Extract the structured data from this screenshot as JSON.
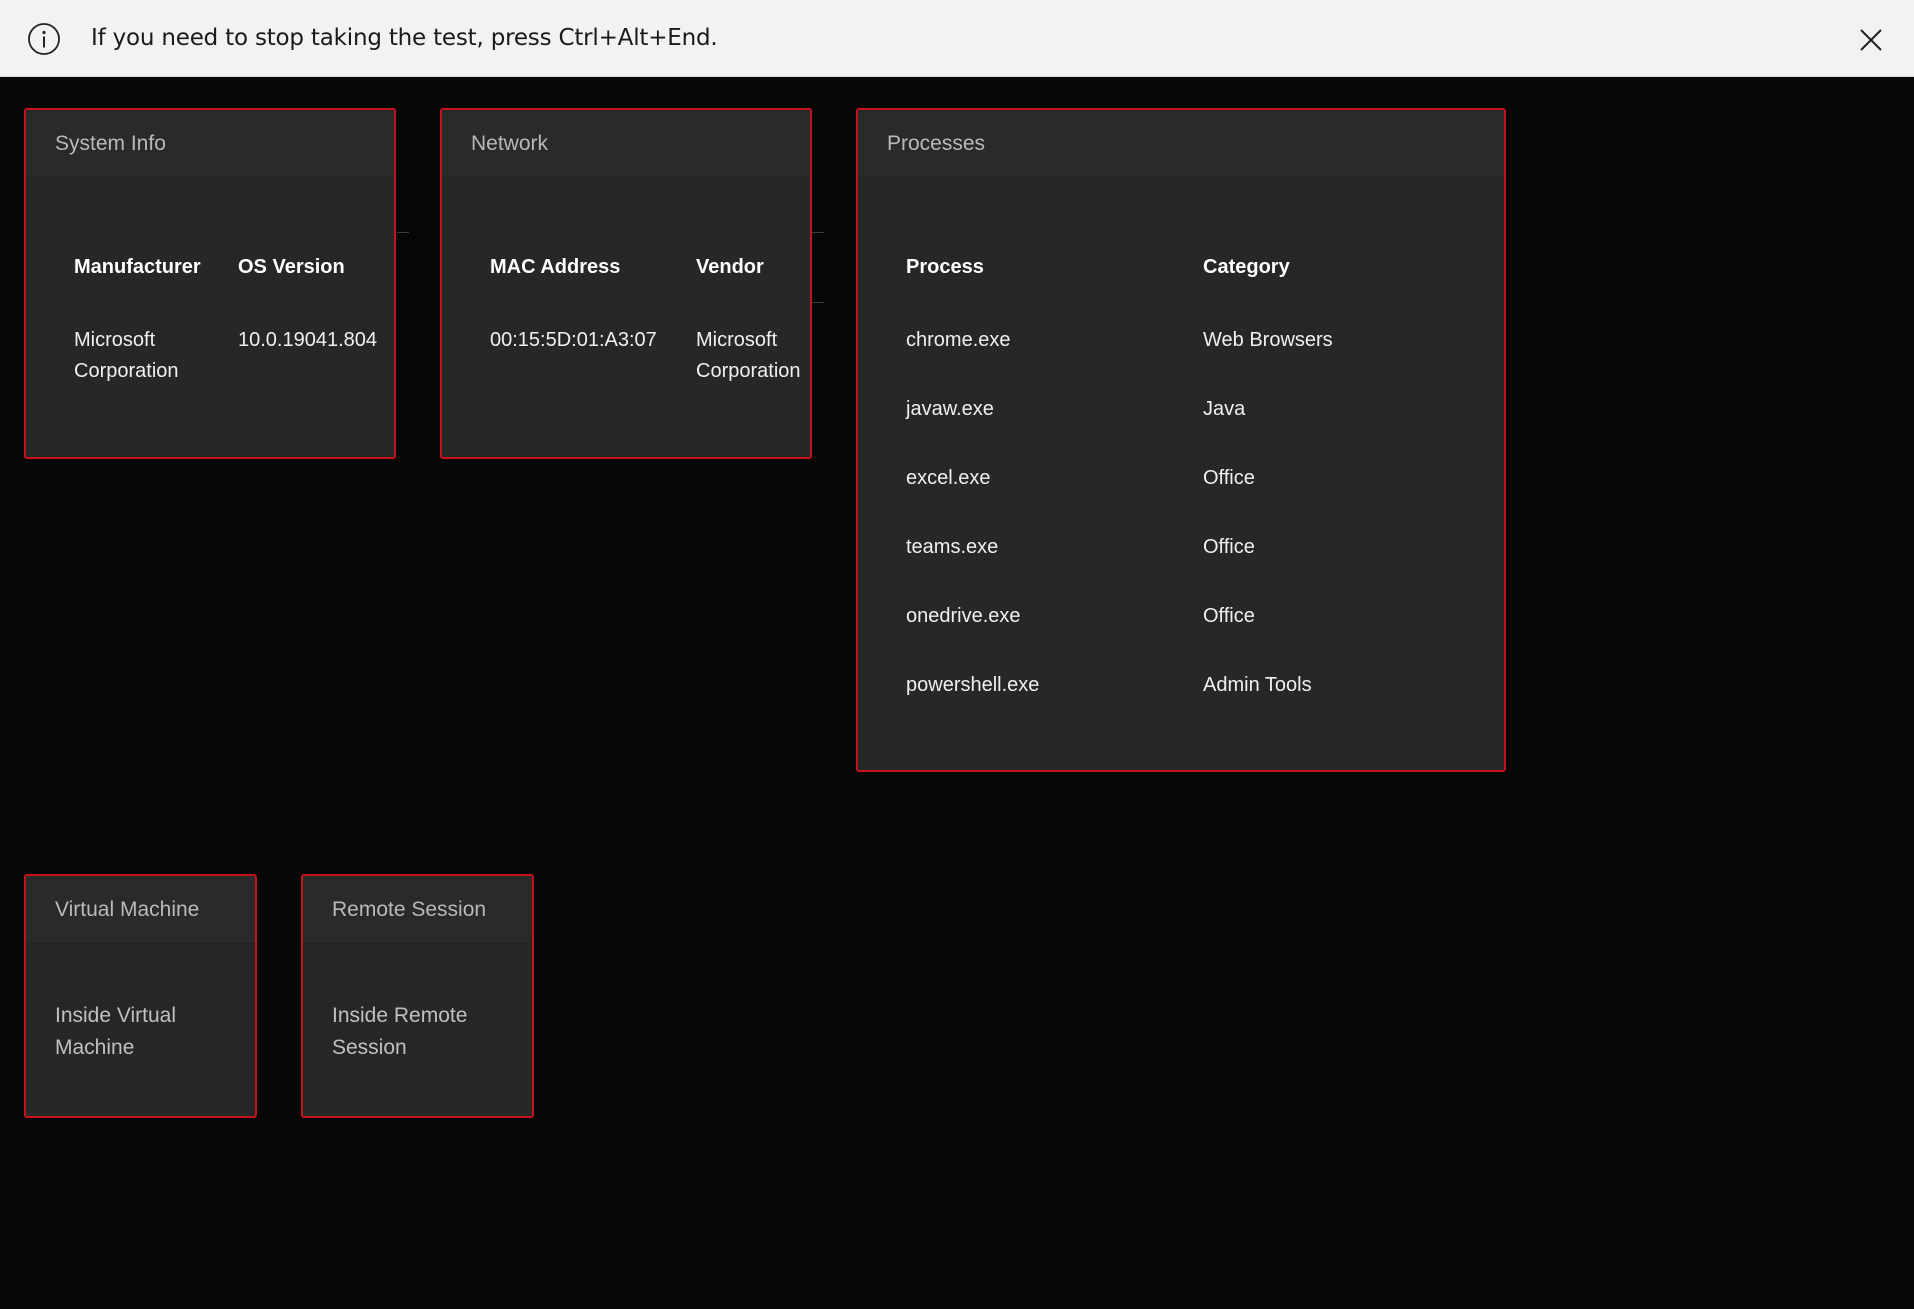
{
  "infobar": {
    "message": "If you need to stop taking the test, press Ctrl+Alt+End.",
    "info_icon": "info-circle-icon",
    "close_icon": "close-icon"
  },
  "system_info": {
    "title": "System Info",
    "columns": [
      "Manufacturer",
      "OS Version"
    ],
    "row": {
      "manufacturer_line1": "Microsoft",
      "manufacturer_line2": "Corporation",
      "os_version": "10.0.19041.804"
    }
  },
  "network": {
    "title": "Network",
    "columns": [
      "MAC Address",
      "Vendor"
    ],
    "row": {
      "mac": "00:15:5D:01:A3:07",
      "vendor_line1": "Microsoft",
      "vendor_line2": "Corporation"
    }
  },
  "processes": {
    "title": "Processes",
    "columns": [
      "Process",
      "Category"
    ],
    "rows": [
      {
        "process": "chrome.exe",
        "category": "Web Browsers"
      },
      {
        "process": "javaw.exe",
        "category": "Java"
      },
      {
        "process": "excel.exe",
        "category": "Office"
      },
      {
        "process": "teams.exe",
        "category": "Office"
      },
      {
        "process": "onedrive.exe",
        "category": "Office"
      },
      {
        "process": "powershell.exe",
        "category": "Admin Tools"
      }
    ]
  },
  "virtual_machine": {
    "title": "Virtual Machine",
    "line1": "Inside Virtual",
    "line2": "Machine"
  },
  "remote_session": {
    "title": "Remote Session",
    "line1": "Inside Remote",
    "line2": "Session"
  },
  "colors": {
    "background": "#070707",
    "panel": "#272727",
    "panel_border": "#c8121b",
    "infobar": "#f2f2f2"
  }
}
